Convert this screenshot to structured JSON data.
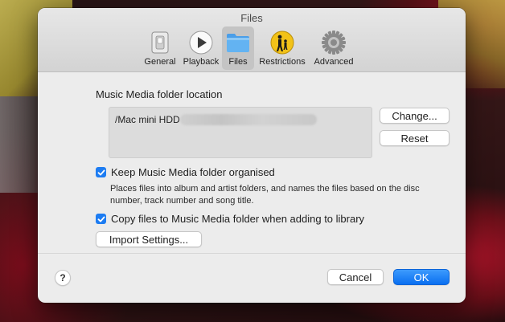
{
  "window": {
    "title": "Files"
  },
  "toolbar": {
    "items": [
      {
        "label": "General",
        "icon": "switch-icon"
      },
      {
        "label": "Playback",
        "icon": "play-icon"
      },
      {
        "label": "Files",
        "icon": "folder-icon",
        "active": true
      },
      {
        "label": "Restrictions",
        "icon": "parental-controls-icon"
      },
      {
        "label": "Advanced",
        "icon": "gear-icon"
      }
    ]
  },
  "files": {
    "folder_location_label": "Music Media folder location",
    "folder_path": "/Mac mini HDD",
    "change_button": "Change...",
    "reset_button": "Reset",
    "keep_organised": {
      "label": "Keep Music Media folder organised",
      "checked": true
    },
    "keep_organised_description": "Places files into album and artist folders, and names the files based on the disc number, track number and song title.",
    "copy_files": {
      "label": "Copy files to Music Media folder when adding to library",
      "checked": true
    },
    "import_settings_button": "Import Settings..."
  },
  "footer": {
    "help_label": "?",
    "cancel_button": "Cancel",
    "ok_button": "OK"
  },
  "colors": {
    "accent": "#1d7cf2",
    "window_bg": "#ececec"
  }
}
